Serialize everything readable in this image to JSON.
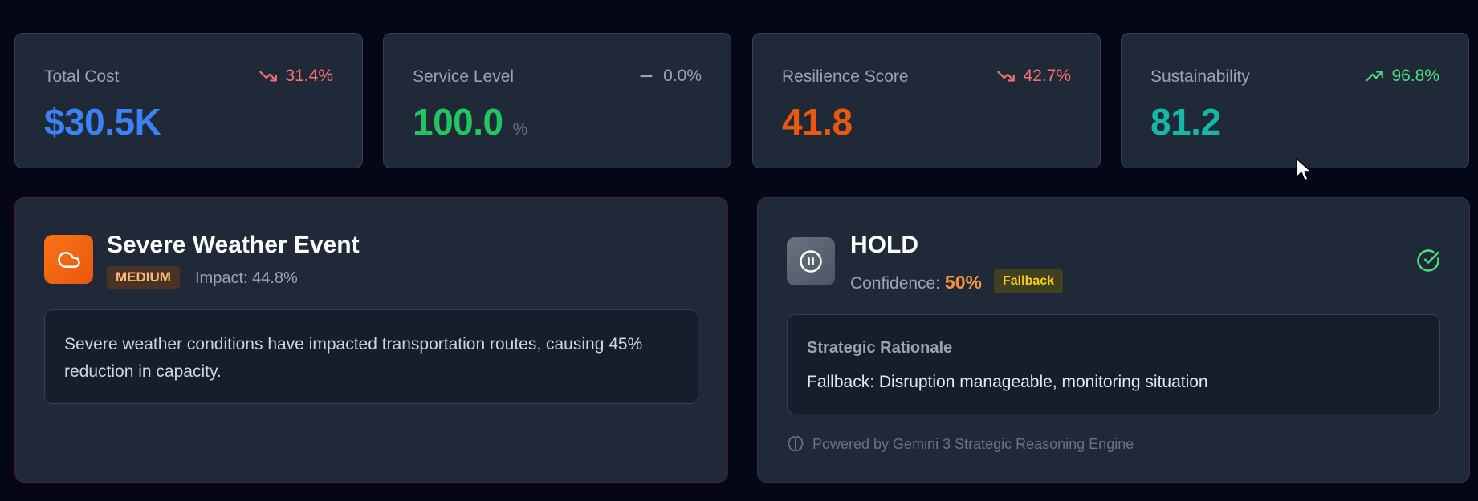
{
  "kpis": [
    {
      "label": "Total Cost",
      "value": "$30.5K",
      "unit": "",
      "trend": "31.4%",
      "trend_direction": "down",
      "value_color": "#3b82f6",
      "trend_color": "#f87171"
    },
    {
      "label": "Service Level",
      "value": "100.0",
      "unit": "%",
      "trend": "0.0%",
      "trend_direction": "flat",
      "value_color": "#22c55e",
      "trend_color": "#9ca3af"
    },
    {
      "label": "Resilience Score",
      "value": "41.8",
      "unit": "",
      "trend": "42.7%",
      "trend_direction": "down",
      "value_color": "#ea580c",
      "trend_color": "#f87171"
    },
    {
      "label": "Sustainability",
      "value": "81.2",
      "unit": "",
      "trend": "96.8%",
      "trend_direction": "up",
      "value_color": "#14b8a6",
      "trend_color": "#4ade80"
    }
  ],
  "event": {
    "icon": "cloud-icon",
    "title": "Severe Weather Event",
    "severity": "MEDIUM",
    "impact": "Impact: 44.8%",
    "description": "Severe weather conditions have impacted transportation routes, causing 45% reduction in capacity."
  },
  "decision": {
    "icon": "pause-icon",
    "action": "HOLD",
    "confidence_label": "Confidence:",
    "confidence_value": "50%",
    "badge": "Fallback",
    "status_icon": "check-circle-icon",
    "rationale_title": "Strategic Rationale",
    "rationale_text": "Fallback: Disruption manageable, monitoring situation",
    "powered_by": "Powered by Gemini 3 Strategic Reasoning Engine",
    "powered_icon": "brain-icon"
  },
  "colors": {
    "background": "#060716",
    "card": "#1f2937",
    "event_border": "#4c1d2e"
  }
}
